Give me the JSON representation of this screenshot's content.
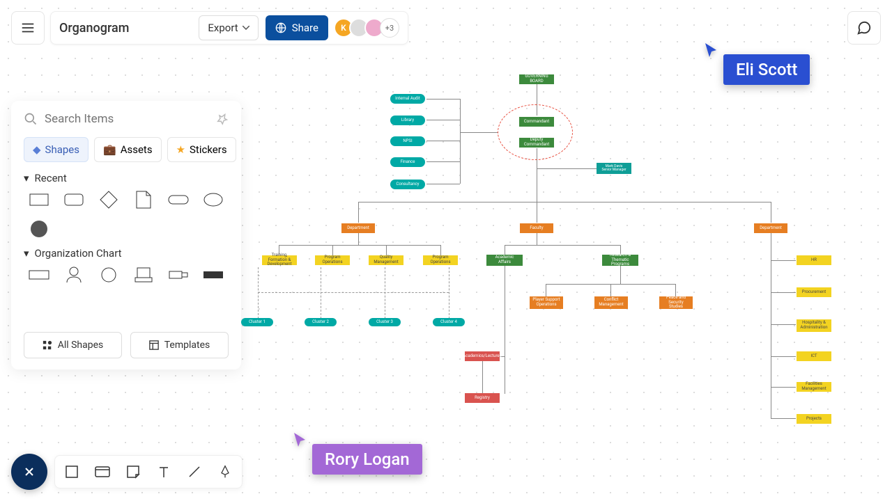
{
  "doc": {
    "title": "Organogram"
  },
  "toolbar": {
    "export": "Export",
    "share": "Share",
    "avatar_more": "+3",
    "avatar_initial": "K"
  },
  "search": {
    "placeholder": "Search Items"
  },
  "tabs": {
    "shapes": "Shapes",
    "assets": "Assets",
    "stickers": "Stickers"
  },
  "sections": {
    "recent": "Recent",
    "orgchart": "Organization Chart"
  },
  "buttons": {
    "all_shapes": "All Shapes",
    "templates": "Templates"
  },
  "cursors": {
    "eli": "Eli Scott",
    "rory": "Rory Logan"
  },
  "colors": {
    "eli": "#2a4fd1",
    "rory": "#a368d6"
  },
  "org": {
    "top": "GOVERNING BOARD",
    "commandant": "Commandant",
    "deputy": "Deputy Commandant",
    "side": [
      "Internal Audit",
      "Library",
      "NPSI",
      "Finance",
      "Consultancy"
    ],
    "mark": "Mark Davis\nSenior Manager",
    "dept_l": "Department",
    "faculty": "Faculty",
    "dept_r": "Department",
    "yellow_l": [
      "Training, Formation & Development",
      "Program Operations",
      "Quality Management",
      "Program Operations"
    ],
    "cluster": [
      "Cluster 1",
      "Cluster 2",
      "Cluster 3",
      "Cluster 4"
    ],
    "acad": "Academic Affairs",
    "research": "Research & Thematic Programs",
    "orange2": [
      "Player Support Operations",
      "Conflict Management",
      "Peace and Security Studies"
    ],
    "red1": "Academics/Lectures",
    "red2": "Registry",
    "right": [
      "HR",
      "Procurement",
      "Hospitality & Administration",
      "ICT",
      "Facilities Management",
      "Projects"
    ]
  }
}
